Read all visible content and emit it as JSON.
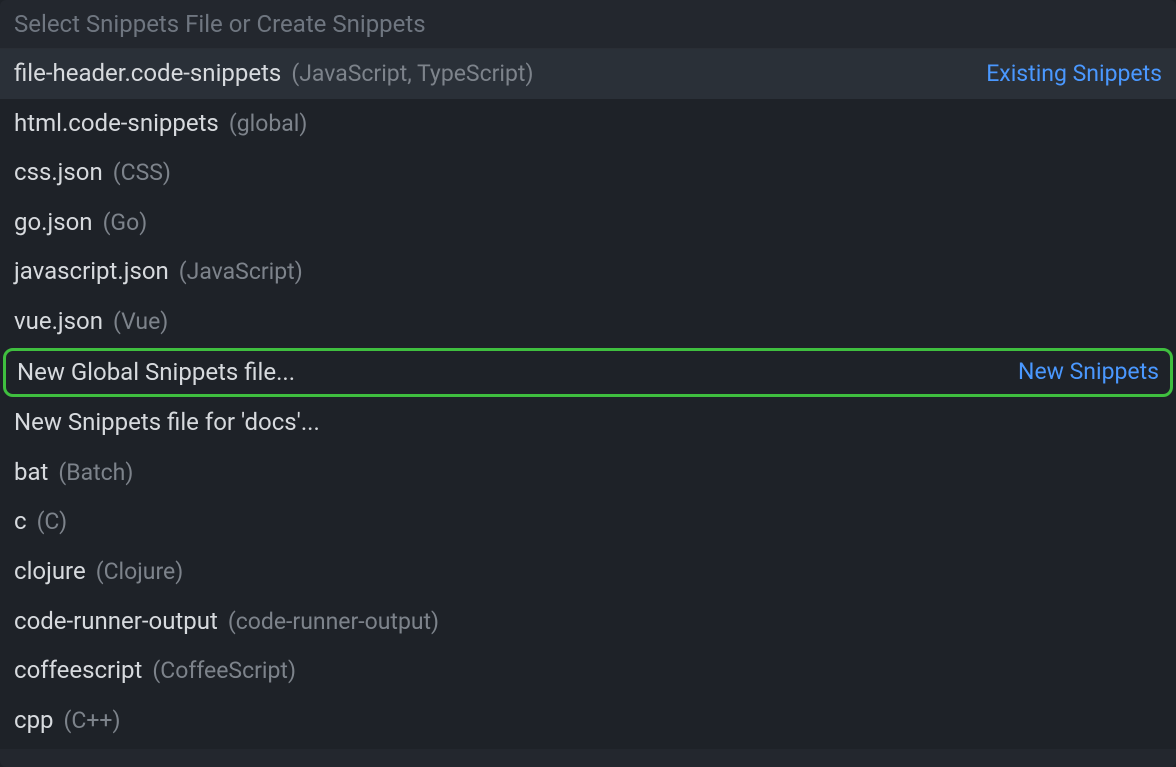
{
  "input": {
    "placeholder": "Select Snippets File or Create Snippets",
    "value": ""
  },
  "groups": {
    "existing": "Existing Snippets",
    "new": "New Snippets"
  },
  "items": [
    {
      "label": "file-header.code-snippets",
      "detail": "(JavaScript, TypeScript)",
      "group": "Existing Snippets",
      "selected": true,
      "highlighted": false
    },
    {
      "label": "html.code-snippets",
      "detail": "(global)",
      "group": "",
      "selected": false,
      "highlighted": false
    },
    {
      "label": "css.json",
      "detail": "(CSS)",
      "group": "",
      "selected": false,
      "highlighted": false
    },
    {
      "label": "go.json",
      "detail": "(Go)",
      "group": "",
      "selected": false,
      "highlighted": false
    },
    {
      "label": "javascript.json",
      "detail": "(JavaScript)",
      "group": "",
      "selected": false,
      "highlighted": false
    },
    {
      "label": "vue.json",
      "detail": "(Vue)",
      "group": "",
      "selected": false,
      "highlighted": false
    },
    {
      "label": "New Global Snippets file...",
      "detail": "",
      "group": "New Snippets",
      "selected": false,
      "highlighted": true
    },
    {
      "label": "New Snippets file for 'docs'...",
      "detail": "",
      "group": "",
      "selected": false,
      "highlighted": false
    },
    {
      "label": "bat",
      "detail": "(Batch)",
      "group": "",
      "selected": false,
      "highlighted": false
    },
    {
      "label": "c",
      "detail": "(C)",
      "group": "",
      "selected": false,
      "highlighted": false
    },
    {
      "label": "clojure",
      "detail": "(Clojure)",
      "group": "",
      "selected": false,
      "highlighted": false
    },
    {
      "label": "code-runner-output",
      "detail": "(code-runner-output)",
      "group": "",
      "selected": false,
      "highlighted": false
    },
    {
      "label": "coffeescript",
      "detail": "(CoffeeScript)",
      "group": "",
      "selected": false,
      "highlighted": false
    },
    {
      "label": "cpp",
      "detail": "(C++)",
      "group": "",
      "selected": false,
      "highlighted": false
    }
  ]
}
